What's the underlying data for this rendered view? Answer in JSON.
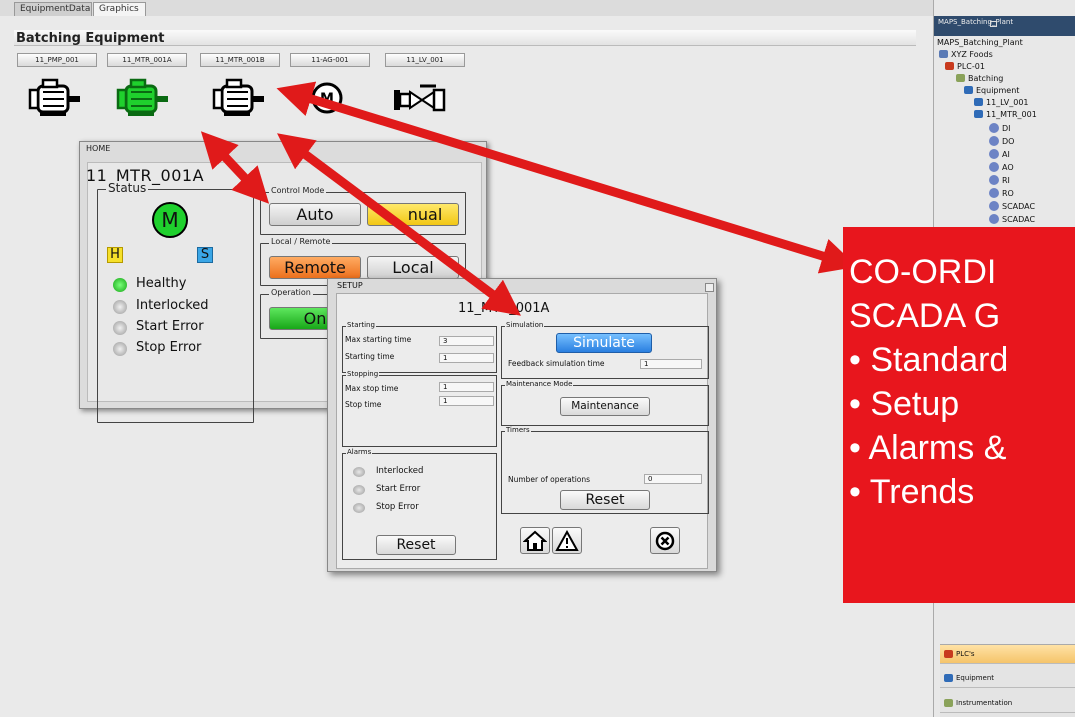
{
  "window_tabs": {
    "equipment_data": "EquipmentData",
    "graphics": "Graphics"
  },
  "page_title": "Batching Equipment",
  "equipment_buttons": [
    "11_PMP_001",
    "11_MTR_001A",
    "11_MTR_001B",
    "11-AG-001",
    "11_LV_001"
  ],
  "home_window": {
    "title": "HOME",
    "equipment_name": "11_MTR_001A",
    "status_label": "Status",
    "motor_symbol": "M",
    "h_badge": "H",
    "s_badge": "S",
    "status_items": [
      "Healthy",
      "Interlocked",
      "Start Error",
      "Stop Error"
    ],
    "control_mode_label": "Control Mode",
    "auto_label": "Auto",
    "manual_label": "Manual",
    "manual_visible": "nual",
    "local_remote_label": "Local / Remote",
    "remote_label": "Remote",
    "local_label": "Local",
    "operation_label": "Operation",
    "on_label": "On"
  },
  "setup_window": {
    "title": "SETUP",
    "equipment_name": "11_MTR_001A",
    "starting_group": "Starting",
    "max_starting_time_label": "Max starting time",
    "max_starting_time_value": "3",
    "starting_time_label": "Starting time",
    "starting_time_value": "1",
    "stopping_group": "Stopping",
    "max_stop_time_label": "Max stop time",
    "max_stop_time_value": "1",
    "stop_time_label": "Stop time",
    "stop_time_value": "1",
    "simulation_group": "Simulation",
    "simulate_label": "Simulate",
    "feedback_sim_label": "Feedback simulation time",
    "feedback_sim_value": "1",
    "maintenance_group": "Maintenance Mode",
    "maintenance_label": "Maintenance",
    "alarms_group": "Alarms",
    "alarm_items": [
      "Interlocked",
      "Start Error",
      "Stop Error"
    ],
    "alarms_reset_label": "Reset",
    "timers_group": "Timers",
    "num_operations_label": "Number of operations",
    "num_operations_value": "0",
    "timers_reset_label": "Reset"
  },
  "tree_panel": {
    "tab_title": "MAPS_Batching_Plant",
    "items": [
      "MAPS_Batching_Plant",
      "XYZ Foods",
      "PLC-01",
      "Batching",
      "Equipment",
      "11_LV_001",
      "11_MTR_001"
    ],
    "signals": [
      "DI",
      "DO",
      "AI",
      "AO",
      "RI",
      "RO",
      "SCADAC",
      "SCADAC"
    ],
    "bottom_buttons": [
      "PLC's",
      "Equipment",
      "Instrumentation"
    ]
  },
  "overlay": {
    "lines": [
      "CO-ORDI",
      "SCADA G",
      "• Standard",
      "• Setup",
      "• Alarms &",
      "• Trends"
    ]
  },
  "colors": {
    "accent_red": "#e8161d",
    "motor_green": "#1fd02d",
    "manual_yellow": "#f6d320",
    "remote_orange": "#f2822a",
    "simulate_blue": "#3a8fe8"
  }
}
